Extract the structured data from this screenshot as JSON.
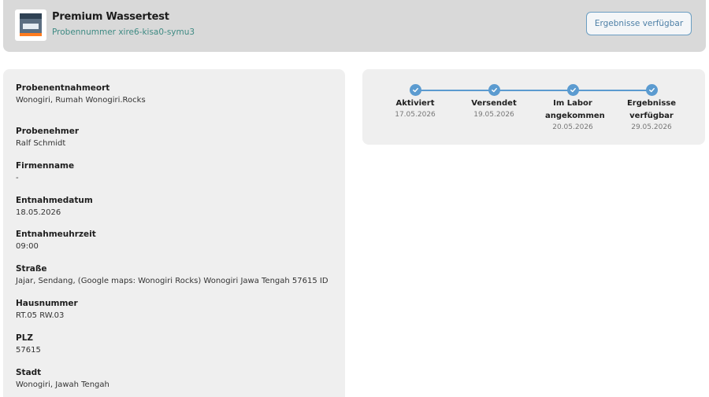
{
  "header": {
    "title": "Premium Wassertest",
    "subtitle": "Probennummer xire6-kisa0-symu3",
    "status_button": "Ergebnisse verfügbar"
  },
  "details": [
    {
      "label": "Probenentnahmeort",
      "value": "Wonogiri, Rumah Wonogiri.Rocks"
    },
    {
      "label": "Probenehmer",
      "value": "Ralf Schmidt"
    },
    {
      "label": "Firmenname",
      "value": "-"
    },
    {
      "label": "Entnahmedatum",
      "value": "18.05.2026"
    },
    {
      "label": "Entnahmeuhrzeit",
      "value": "09:00"
    },
    {
      "label": "Straße",
      "value": "Jajar, Sendang, (Google maps: Wonogiri Rocks) Wonogiri Jawa Tengah 57615 ID"
    },
    {
      "label": "Hausnummer",
      "value": "RT.05 RW.03"
    },
    {
      "label": "PLZ",
      "value": "57615"
    },
    {
      "label": "Stadt",
      "value": "Wonogiri, Jawah Tengah"
    }
  ],
  "timeline": [
    {
      "label": "Aktiviert",
      "date": "17.05.2026"
    },
    {
      "label": "Versendet",
      "date": "19.05.2026"
    },
    {
      "label": "Im Labor angekommen",
      "date": "20.05.2026"
    },
    {
      "label": "Ergebnisse verfügbar",
      "date": "29.05.2026"
    }
  ],
  "colors": {
    "accent": "#5b9bd0",
    "subtitle": "#3e8a83",
    "card_bg": "#efefef",
    "header_bg": "#d9d9d9"
  },
  "icons": {
    "product": "product-box-icon",
    "step": "check-icon"
  }
}
